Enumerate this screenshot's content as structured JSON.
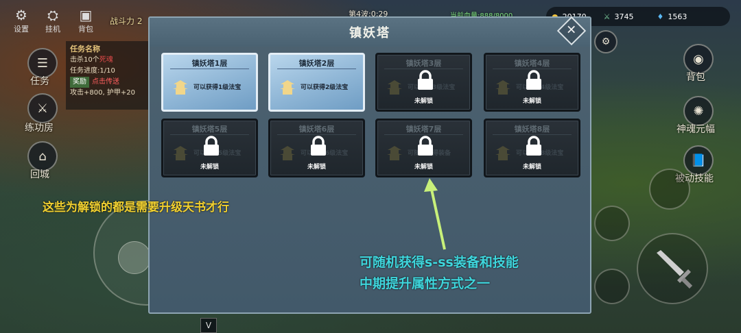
{
  "hud": {
    "top_left": [
      "设置",
      "挂机",
      "背包"
    ],
    "battle_power_label": "战斗力 2",
    "wave": "第4波:0:29",
    "top_status": "当前血量:888/8000",
    "resources": [
      {
        "icon": "coin-icon",
        "value": "20170"
      },
      {
        "icon": "crossed-swords-icon",
        "value": "3745"
      },
      {
        "icon": "flame-icon",
        "value": "1563"
      }
    ],
    "left_menu": [
      {
        "label": "任务",
        "icon": "scroll-icon"
      },
      {
        "label": "练功房",
        "icon": "training-icon"
      },
      {
        "label": "回城",
        "icon": "town-icon"
      }
    ],
    "right_menu": [
      {
        "label": "背包",
        "icon": "bag-icon"
      },
      {
        "label": "神魂元幅",
        "icon": "soul-icon"
      },
      {
        "label": "被动技能",
        "icon": "book-icon"
      }
    ],
    "bottom_toggle": "V"
  },
  "quest": {
    "title": "任务名称",
    "line1_prefix": "击杀10个",
    "line1_target": "死魂",
    "progress": "任务进度:1/10",
    "reward_tag": "奖励",
    "teleport": "点击传送",
    "reward_detail": "攻击+800, 护甲+20"
  },
  "panel": {
    "title": "镇妖塔",
    "close_label": "✕",
    "towers": [
      {
        "title": "镇妖塔1层",
        "desc": "可以获得1级法宝",
        "locked": false
      },
      {
        "title": "镇妖塔2层",
        "desc": "可以获得2级法宝",
        "locked": false
      },
      {
        "title": "镇妖塔3层",
        "desc": "可以获得3级法宝",
        "locked": true,
        "lock_label": "未解锁"
      },
      {
        "title": "镇妖塔4层",
        "desc": "可以获得4级法宝",
        "locked": true,
        "lock_label": "未解锁"
      },
      {
        "title": "镇妖塔5层",
        "desc": "可以获得5级法宝",
        "locked": true,
        "lock_label": "未解锁"
      },
      {
        "title": "镇妖塔6层",
        "desc": "可以获得6级法宝",
        "locked": true,
        "lock_label": "未解锁"
      },
      {
        "title": "镇妖塔7层",
        "desc": "可随机获得装备",
        "locked": true,
        "lock_label": "未解锁"
      },
      {
        "title": "镇妖塔8层",
        "desc": "可以获得8级法宝",
        "locked": true,
        "lock_label": "未解锁"
      }
    ]
  },
  "annotations": {
    "left": "这些为解锁的都是需要升级天书才行",
    "right_line1": "可随机获得s-ss装备和技能",
    "right_line2": "中期提升属性方式之一",
    "arrow_color": "#c8f07a"
  },
  "colors": {
    "panel_bg": "#46606f",
    "unlocked_card": "#a7c8e3",
    "locked_card": "#252c33",
    "annotation_yellow": "#f1d030",
    "annotation_cyan": "#3fd6dd"
  }
}
